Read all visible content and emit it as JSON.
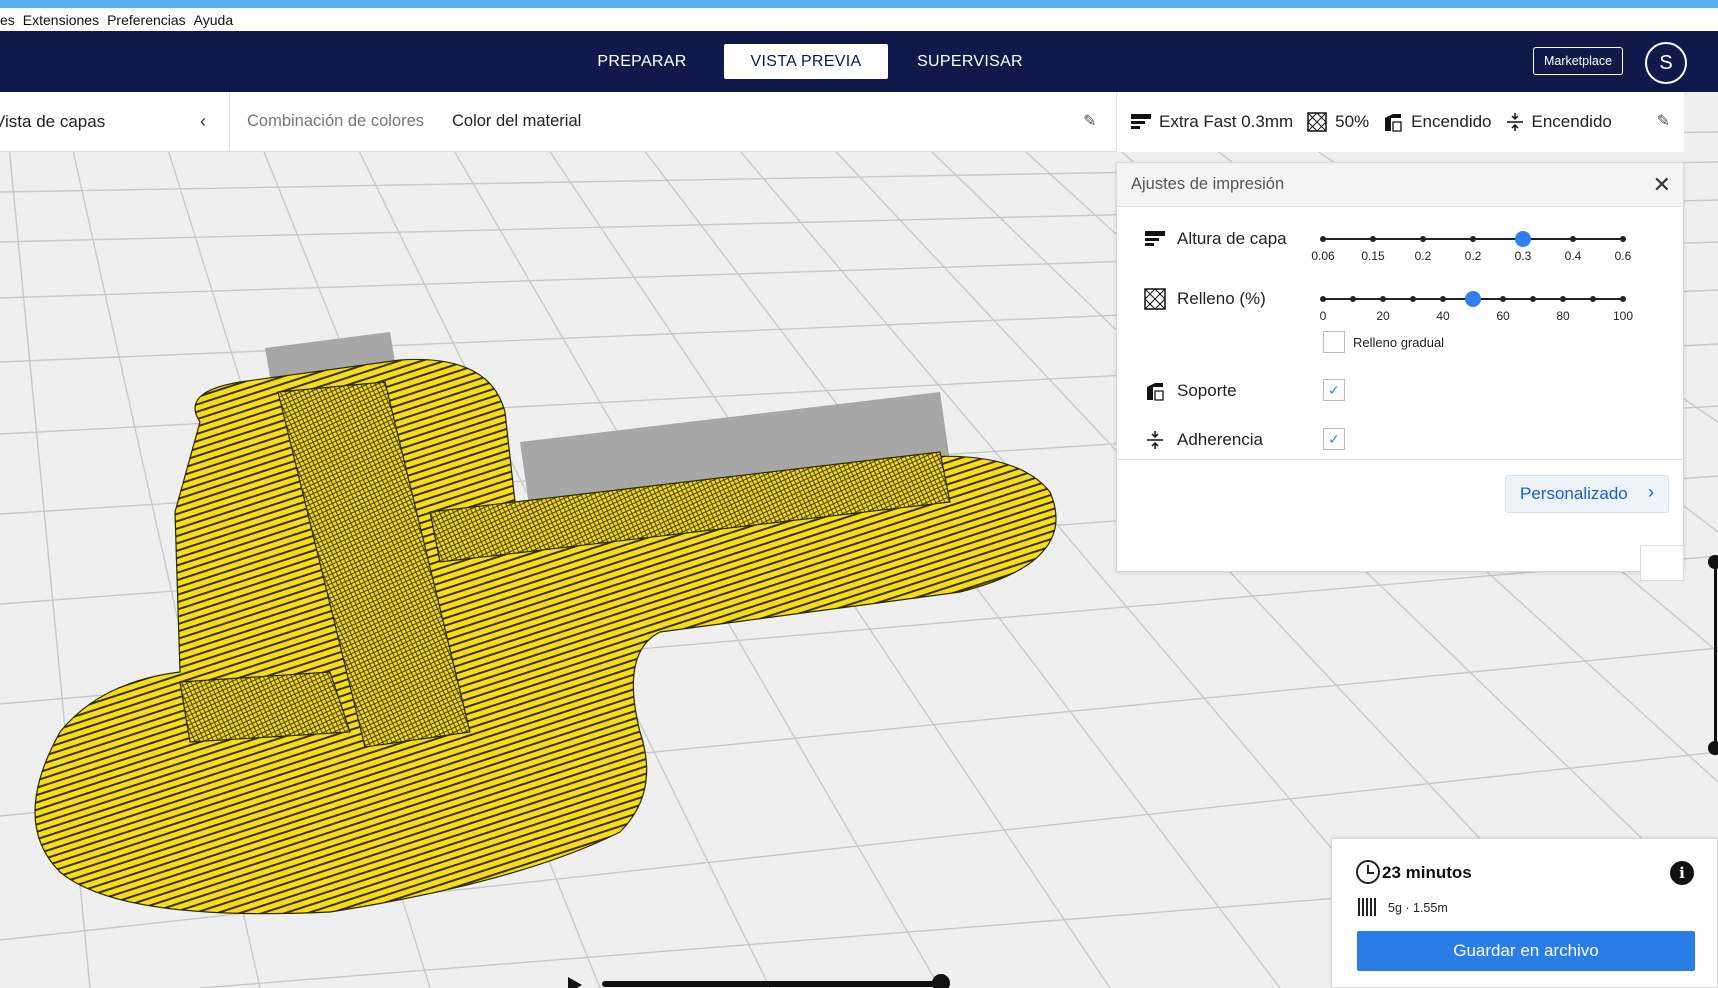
{
  "menu": {
    "items": [
      "es",
      "Extensiones",
      "Preferencias",
      "Ayuda"
    ]
  },
  "header": {
    "tabs": [
      {
        "label": "PREPARAR",
        "active": false
      },
      {
        "label": "VISTA PREVIA",
        "active": true
      },
      {
        "label": "SUPERVISAR",
        "active": false
      }
    ],
    "marketplace": "Marketplace",
    "avatar_initial": "S"
  },
  "view_toolbar": {
    "view_type": "Vista de capas",
    "color_scheme_label": "Combinación de colores",
    "color_scheme_value": "Color del material"
  },
  "print_summary": {
    "profile": "Extra Fast 0.3mm",
    "infill": "50%",
    "support": "Encendido",
    "adhesion": "Encendido"
  },
  "print_settings": {
    "title": "Ajustes de impresión",
    "layer_height": {
      "label": "Altura de capa",
      "ticks": [
        "0.06",
        "0.15",
        "0.2",
        "0.2",
        "0.3",
        "0.4",
        "0.6"
      ],
      "selected_index": 4
    },
    "infill": {
      "label": "Relleno (%)",
      "ticks": [
        "0",
        "20",
        "40",
        "60",
        "80",
        "100"
      ],
      "value": 50,
      "gradual_label": "Relleno gradual",
      "gradual_checked": false
    },
    "support": {
      "label": "Soporte",
      "checked": true
    },
    "adhesion": {
      "label": "Adherencia",
      "checked": true
    },
    "custom_button": "Personalizado"
  },
  "estimate": {
    "time": "23 minutos",
    "material": "5g · 1.55m",
    "save_button": "Guardar en archivo"
  },
  "colors": {
    "header_bg": "#0f1a4a",
    "accent": "#2f7ff2",
    "model_yellow": "#f5dc1f",
    "save_blue": "#2a7de6"
  }
}
